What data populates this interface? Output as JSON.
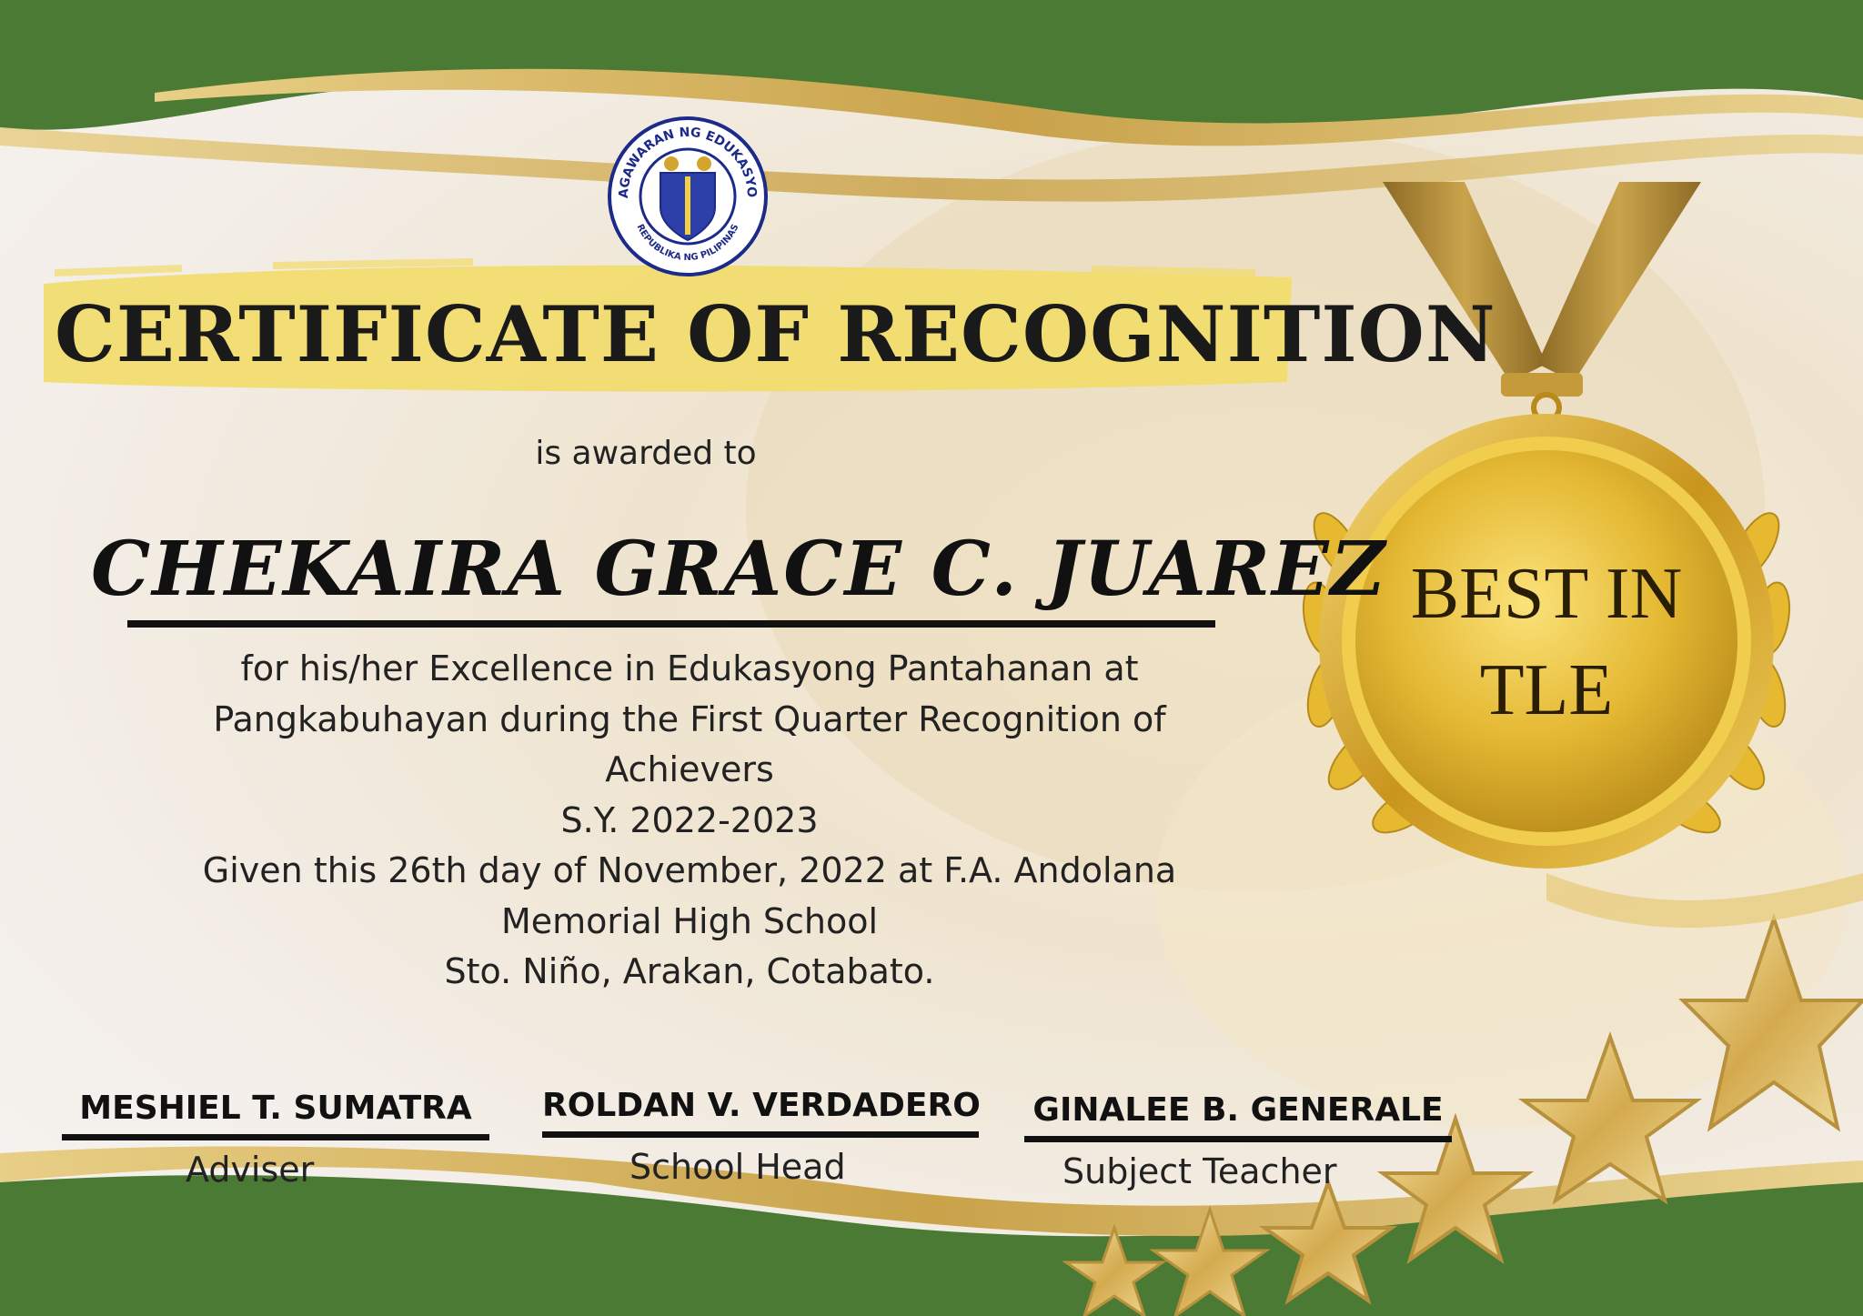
{
  "seal": {
    "top_text": "KAGAWARAN NG EDUKASYON",
    "bottom_text": "REPUBLIKA NG PILIPINAS"
  },
  "certificate": {
    "title": "CERTIFICATE  OF RECOGNITION",
    "awarded_to": "is awarded to",
    "recipient": "CHEKAIRA GRACE C. JUAREZ",
    "body_lines": [
      "for his/her Excellence in Edukasyong Pantahanan at",
      "Pangkabuhayan during the First Quarter Recognition of",
      "Achievers",
      "S.Y. 2022-2023",
      "Given this 26th day of November, 2022 at F.A. Andolana",
      "Memorial High School",
      "Sto. Niño, Arakan, Cotabato."
    ]
  },
  "medal": {
    "line1": "BEST IN",
    "line2": "TLE"
  },
  "signatories": [
    {
      "name": "MESHIEL T. SUMATRA",
      "role": "Adviser"
    },
    {
      "name": "ROLDAN V. VERDADERO",
      "role": "School Head"
    },
    {
      "name": "GINALEE B. GENERALE",
      "role": "Subject Teacher"
    }
  ],
  "colors": {
    "green": "#4b7a35",
    "gold": "#c9a24a",
    "medal_gold": "#e2b939",
    "highlight_yellow": "#f2dc6b"
  }
}
